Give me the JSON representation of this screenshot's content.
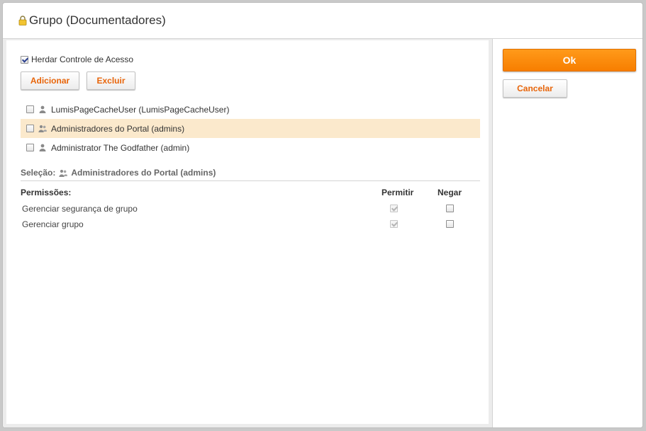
{
  "dialog": {
    "title": "Grupo (Documentadores)",
    "title_icon": "lock-icon"
  },
  "access": {
    "inherit_label": "Herdar Controle de Acesso",
    "inherit_checked": true,
    "add_label": "Adicionar",
    "delete_label": "Excluir"
  },
  "principals": [
    {
      "name": "LumisPageCacheUser (LumisPageCacheUser)",
      "icon": "user-icon",
      "selected": false
    },
    {
      "name": "Administradores do Portal (admins)",
      "icon": "group-icon",
      "selected": true
    },
    {
      "name": "Administrator The Godfather (admin)",
      "icon": "user-icon",
      "selected": false
    }
  ],
  "selection": {
    "label": "Seleção:",
    "icon": "group-icon",
    "value": "Administradores do Portal (admins)"
  },
  "permissions": {
    "header_label": "Permissões:",
    "allow_label": "Permitir",
    "deny_label": "Negar",
    "rows": [
      {
        "label": "Gerenciar segurança de grupo",
        "allow": true,
        "deny": false
      },
      {
        "label": "Gerenciar grupo",
        "allow": true,
        "deny": false
      }
    ]
  },
  "actions": {
    "ok_label": "Ok",
    "cancel_label": "Cancelar"
  },
  "colors": {
    "accent": "#f78a00",
    "link_orange": "#e8650a",
    "selected_row": "#fbe9cc"
  }
}
